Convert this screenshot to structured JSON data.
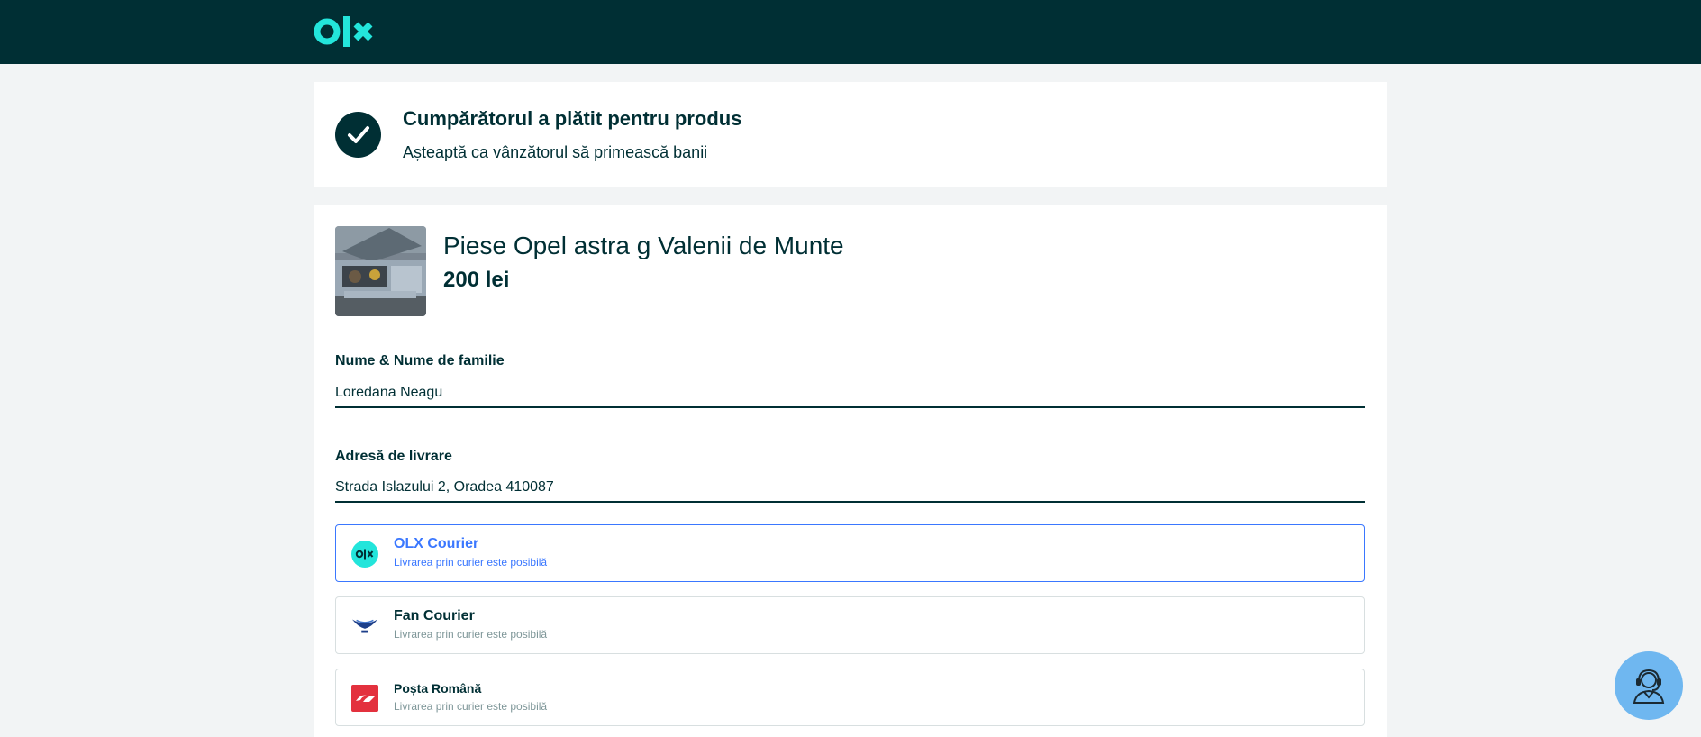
{
  "header": {
    "logo_text": "olx",
    "logo_icon": "olx-logo"
  },
  "status": {
    "icon": "check-icon",
    "title": "Cumpărătorul a plătit pentru produs",
    "subtitle": "Așteaptă ca vânzătorul să primească banii"
  },
  "product": {
    "title": "Piese Opel astra g Valenii de Munte",
    "price": "200 lei"
  },
  "form": {
    "name_label": "Nume & Nume de familie",
    "name_value": "Loredana Neagu",
    "address_label": "Adresă de livrare",
    "address_value": "Strada Islazului 2, Oradea 410087"
  },
  "couriers": [
    {
      "name": "OLX Courier",
      "subtitle": "Livrarea prin curier este posibilă",
      "icon": "olx-courier-icon",
      "selected": true
    },
    {
      "name": "Fan Courier",
      "subtitle": "Livrarea prin curier este posibilă",
      "icon": "fan-courier-icon",
      "selected": false
    },
    {
      "name": "Poșta Română",
      "subtitle": "Livrarea prin curier este posibilă",
      "icon": "posta-romana-icon",
      "selected": false
    }
  ],
  "colors": {
    "brand_dark": "#002f34",
    "brand_teal": "#23e5db",
    "accent_blue": "#3a77ff",
    "support_blue": "#6fb7f0"
  },
  "support": {
    "icon": "support-agent-icon"
  }
}
